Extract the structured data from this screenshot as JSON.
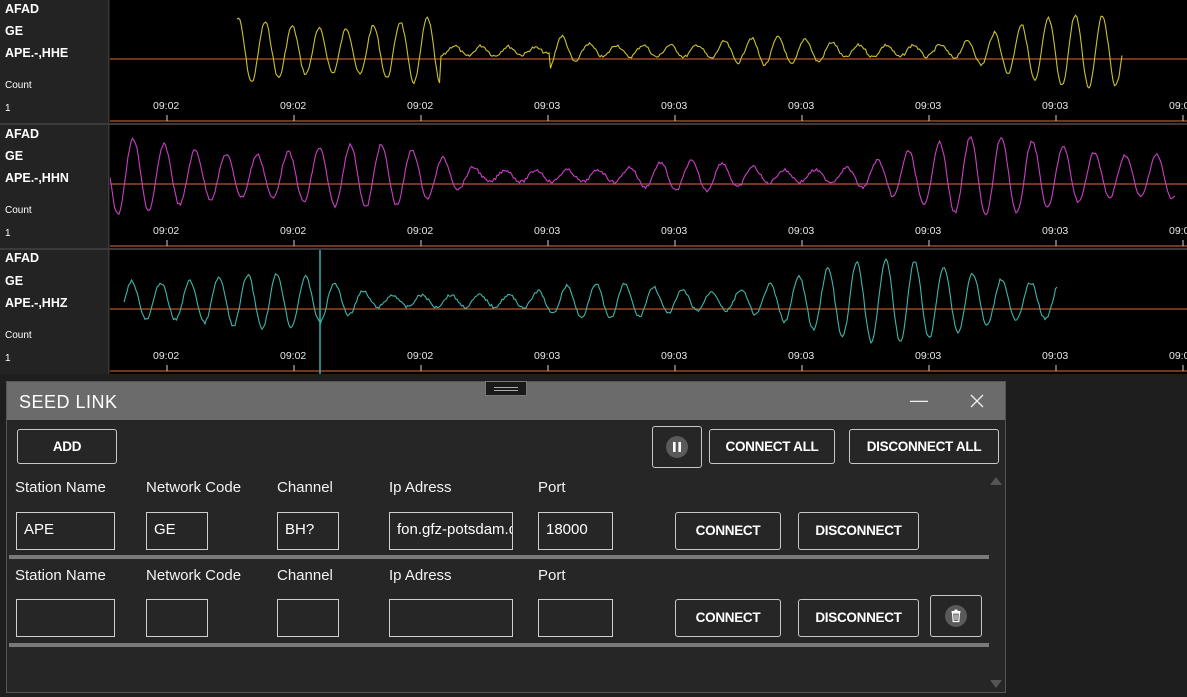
{
  "colors": {
    "hhe": "#c9c12e",
    "hhn": "#c93fc4",
    "hhz": "#3fb5a8",
    "baseline": "#e36a3a",
    "cursor": "#2ec2c2"
  },
  "channels": [
    {
      "network_label": "AFAD",
      "code": "GE",
      "stream": "APE.-,HHE",
      "count_label": "Count",
      "count_value": "1",
      "ticks": [
        "09:02",
        "09:02",
        "09:02",
        "09:03",
        "09:03",
        "09:03",
        "09:03",
        "09:03",
        "09:0"
      ]
    },
    {
      "network_label": "AFAD",
      "code": "GE",
      "stream": "APE.-,HHN",
      "count_label": "Count",
      "count_value": "1",
      "ticks": [
        "09:02",
        "09:02",
        "09:02",
        "09:03",
        "09:03",
        "09:03",
        "09:03",
        "09:03",
        "09:0"
      ]
    },
    {
      "network_label": "AFAD",
      "code": "GE",
      "stream": "APE.-,HHZ",
      "count_label": "Count",
      "count_value": "1",
      "ticks": [
        "09:02",
        "09:02",
        "09:02",
        "09:03",
        "09:03",
        "09:03",
        "09:03",
        "09:03",
        "09:0"
      ]
    }
  ],
  "dialog": {
    "title": "SEED LINK",
    "minimize_icon": "minimize-icon",
    "close_icon": "close-icon",
    "add_label": "ADD",
    "pause_icon": "pause-icon",
    "connect_all_label": "CONNECT ALL",
    "disconnect_all_label": "DISCONNECT ALL",
    "field_labels": {
      "station": "Station Name",
      "network": "Network Code",
      "channel": "Channel",
      "ip": "Ip Adress",
      "port": "Port"
    },
    "rows": [
      {
        "station": "APE",
        "network": "GE",
        "channel": "BH?",
        "ip": "fon.gfz-potsdam.de",
        "port": "18000",
        "connect_label": "CONNECT",
        "disconnect_label": "DISCONNECT"
      },
      {
        "station": "",
        "network": "",
        "channel": "",
        "ip": "",
        "port": "",
        "connect_label": "CONNECT",
        "disconnect_label": "DISCONNECT",
        "delete_icon": "trash-icon"
      }
    ]
  }
}
